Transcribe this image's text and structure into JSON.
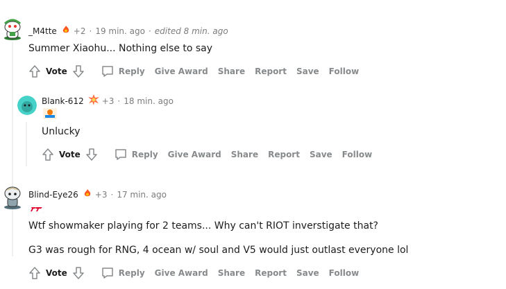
{
  "comments": [
    {
      "username": "_M4tte",
      "points": "+2",
      "time": "19 min. ago",
      "edited": "edited 8 min. ago",
      "body": [
        "Summer Xiaohu... Nothing else to say"
      ],
      "award_icon": "flame-award-icon"
    },
    {
      "username": "Blank-612",
      "points": "+3",
      "time": "18 min. ago",
      "body": [
        "Unlucky"
      ],
      "award_icon": "burst-award-icon"
    },
    {
      "username": "Blind-Eye26",
      "points": "+3",
      "time": "17 min. ago",
      "body": [
        "Wtf showmaker playing for 2 teams... Why can't RIOT inverstigate that?",
        "G3 was rough for RNG, 4 ocean w/ soul and V5 would just outlast everyone lol"
      ],
      "award_icon": "flame-award-icon"
    }
  ],
  "actions": {
    "vote": "Vote",
    "reply": "Reply",
    "give_award": "Give Award",
    "share": "Share",
    "report": "Report",
    "save": "Save",
    "follow": "Follow"
  },
  "colors": {
    "thread_line": "#edeff1",
    "meta_text": "#7c7c7c",
    "action_text": "#878a8c"
  }
}
